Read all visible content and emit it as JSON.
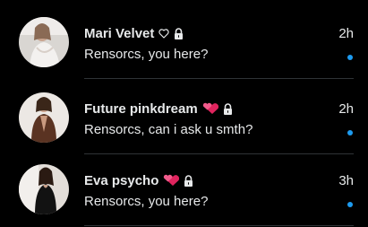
{
  "colors": {
    "background": "#000000",
    "text": "#e7e9ea",
    "unread_dot": "#1d9bf0",
    "divider": "#2f3336",
    "heart_pink": "#e0245e"
  },
  "conversations": [
    {
      "name": "Mari Velvet",
      "badge_icon": "white-heart-outline-icon",
      "locked_icon": "lock-icon",
      "message": "Rensorcs, you here?",
      "time": "2h",
      "unread": true
    },
    {
      "name": "Future pinkdream",
      "badge_icon": "two-pink-hearts-icon",
      "locked_icon": "lock-icon",
      "message": "Rensorcs, can i ask u smth?",
      "time": "2h",
      "unread": true
    },
    {
      "name": "Eva psycho",
      "badge_icon": "two-pink-hearts-icon",
      "locked_icon": "lock-icon",
      "message": "Rensorcs, you here?",
      "time": "3h",
      "unread": true
    }
  ]
}
